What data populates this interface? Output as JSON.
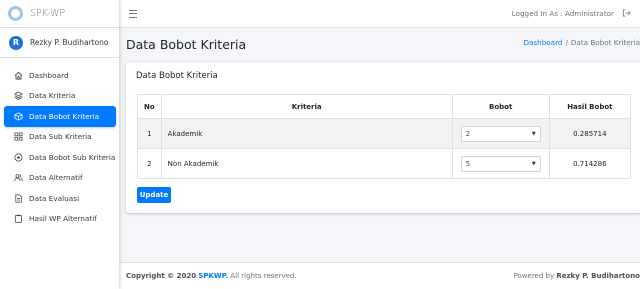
{
  "brand": {
    "name": "SPK-WP"
  },
  "user": {
    "initial": "R",
    "name": "Rezky P. Budihartono"
  },
  "sidebar": {
    "items": [
      {
        "label": "Dashboard",
        "icon": "home-icon",
        "active": false
      },
      {
        "label": "Data Kriteria",
        "icon": "layers-icon",
        "active": false
      },
      {
        "label": "Data Bobot Kriteria",
        "icon": "cube-icon",
        "active": true
      },
      {
        "label": "Data Sub Kriteria",
        "icon": "grid-icon",
        "active": false
      },
      {
        "label": "Data Bobot Sub Kriteria",
        "icon": "target-icon",
        "active": false
      },
      {
        "label": "Data Alternatif",
        "icon": "users-icon",
        "active": false
      },
      {
        "label": "Data Evaluasi",
        "icon": "document-icon",
        "active": false
      },
      {
        "label": "Hasil WP Alternatif",
        "icon": "clipboard-icon",
        "active": false
      }
    ]
  },
  "topbar": {
    "logged_in": "Logged In As : Administrator"
  },
  "header": {
    "title": "Data Bobot Kriteria",
    "breadcrumb_link": "Dashboard",
    "breadcrumb_sep": "/",
    "breadcrumb_current": "Data Bobot Kriteria"
  },
  "card": {
    "title": "Data Bobot Kriteria",
    "columns": [
      "No",
      "Kriteria",
      "Bobot",
      "Hasil Bobot"
    ],
    "rows": [
      {
        "no": "1",
        "kriteria": "Akademik",
        "bobot": "2",
        "hasil": "0.285714"
      },
      {
        "no": "2",
        "kriteria": "Non Akademik",
        "bobot": "5",
        "hasil": "0.714286"
      }
    ],
    "update_label": "Update"
  },
  "footer": {
    "copyright_prefix": "Copyright © 2020",
    "brand": "SPKWP.",
    "rights": "All rights reserved.",
    "powered_prefix": "Powered by",
    "powered_name": "Rezky P. Budihartono"
  },
  "colors": {
    "primary": "#007bff",
    "sidebar_bg": "#ffffff",
    "content_bg": "#f4f6f9"
  }
}
